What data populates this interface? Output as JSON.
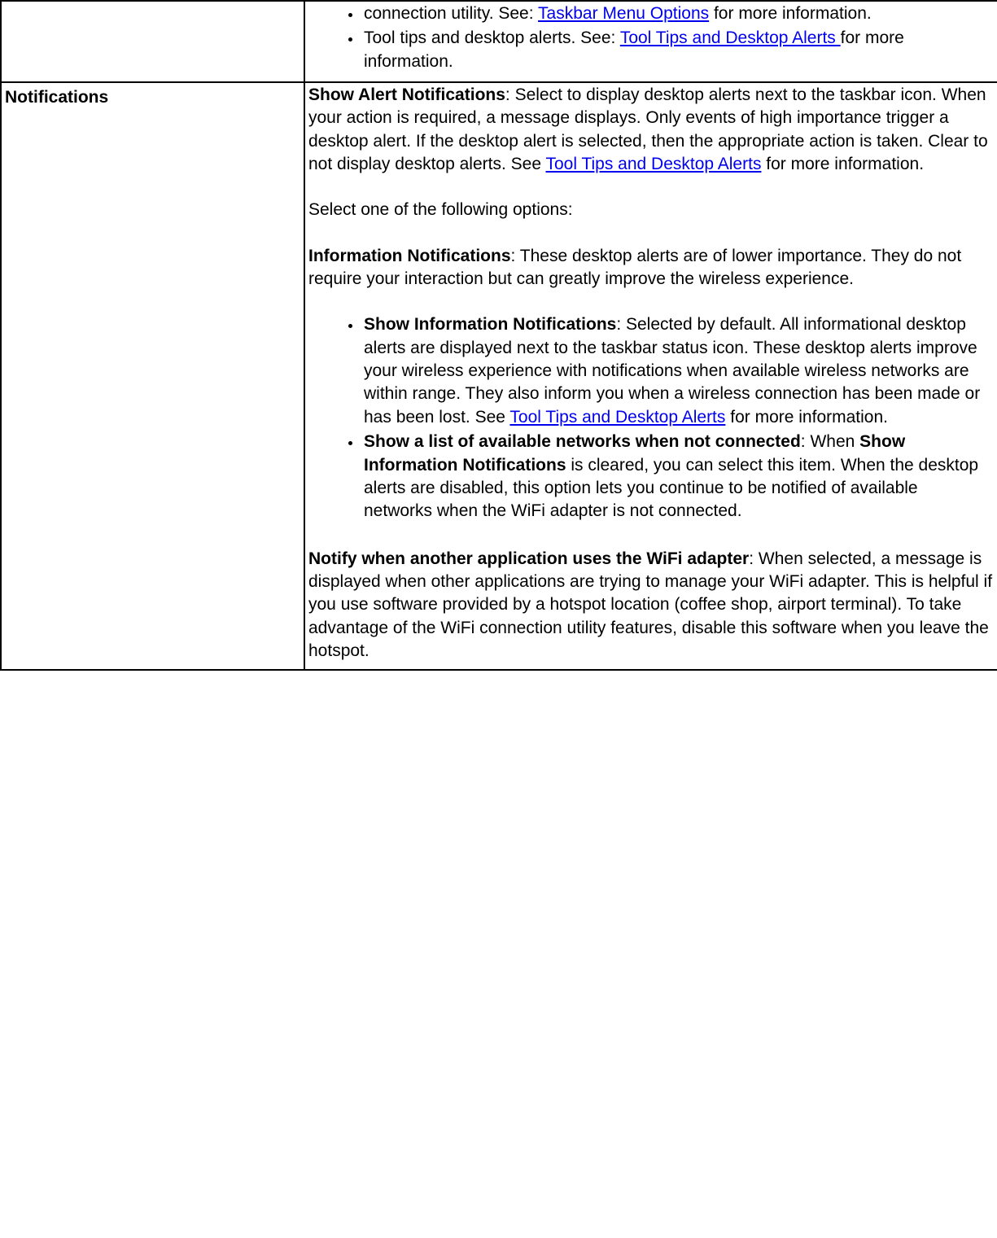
{
  "row1": {
    "label": "",
    "li1_text_a": "connection utility. See: ",
    "li1_link": "Taskbar Menu Options",
    "li1_text_b": " for more information.",
    "li2_text_a": "Tool tips and desktop alerts. See: ",
    "li2_link": "Tool Tips and Desktop Alerts ",
    "li2_text_b": "for more information."
  },
  "row2": {
    "label": "Notifications",
    "p1": {
      "strong": "Show Alert Notifications",
      "text_a": ": Select to display desktop alerts next to the taskbar icon. When your action is required, a message displays. Only events of high importance trigger a desktop alert. If the desktop alert is selected, then the appropriate action is taken. Clear to not display desktop alerts. See ",
      "link": "Tool Tips and Desktop Alerts",
      "text_b": " for more information."
    },
    "p2": "Select one of the following options:",
    "p3": {
      "strong": "Information Notifications",
      "text": ": These desktop alerts are of lower importance. They do not require your interaction but can greatly improve the wireless experience."
    },
    "list": {
      "li1": {
        "strong": "Show Information Notifications",
        "text_a": ": Selected by default. All informational desktop alerts are displayed next to the taskbar status icon. These desktop alerts improve your wireless experience with notifications when available wireless networks are within range. They also inform you when a wireless connection has been made or has been lost. See ",
        "link": "Tool Tips and Desktop Alerts",
        "text_b": " for more information."
      },
      "li2": {
        "strong_a": "Show a list of available networks when not connected",
        "text_a": ": When ",
        "strong_b": "Show Information Notifications",
        "text_b": " is cleared, you can select this item. When the desktop alerts are disabled, this option lets you continue to be notified of available networks when the WiFi adapter is not connected."
      }
    },
    "p4": {
      "strong": "Notify when another application uses the WiFi adapter",
      "text": ": When selected, a message is displayed when other applications are trying to manage your WiFi adapter. This is helpful if you use software provided by a hotspot location (coffee shop, airport terminal). To take advantage of the WiFi connection utility features, disable this software when you leave the hotspot."
    }
  }
}
